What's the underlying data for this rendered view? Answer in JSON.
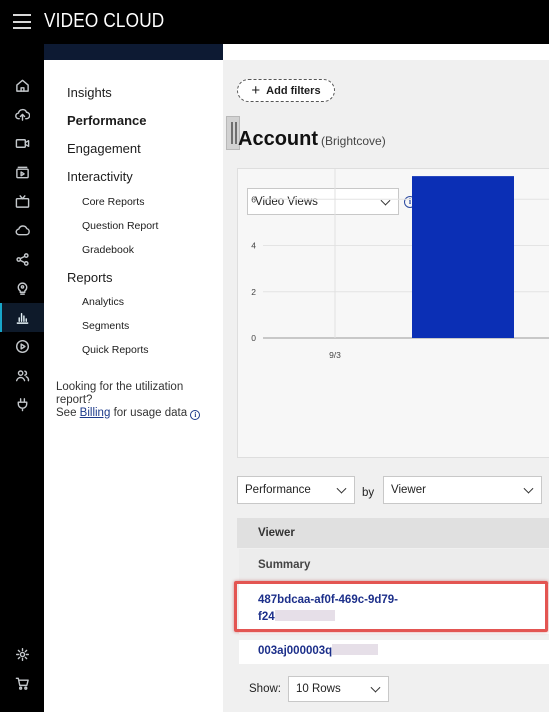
{
  "app": {
    "brand": "VIDEO CLOUD"
  },
  "rail": {
    "items": [
      "home",
      "upload",
      "media",
      "playlists",
      "live",
      "cloud",
      "social",
      "gallery",
      "analytics",
      "players",
      "users",
      "plugins",
      "settings",
      "cart"
    ],
    "active": "analytics"
  },
  "nav": {
    "insights": "Insights",
    "performance": "Performance",
    "engagement": "Engagement",
    "interactivity": "Interactivity",
    "core_reports": "Core Reports",
    "question_report": "Question Report",
    "gradebook": "Gradebook",
    "reports": "Reports",
    "analytics": "Analytics",
    "segments": "Segments",
    "quick_reports": "Quick Reports",
    "util_line1": "Looking for the utilization",
    "util_line2": "report?",
    "util_see": "See",
    "util_billing": "Billing",
    "util_rest": "for usage data"
  },
  "main": {
    "add_filters": "Add filters",
    "account_title": "Account",
    "account_sub": "(Brightcove)",
    "metric_select": "Video Views",
    "group_select": "Performance",
    "by": "by",
    "dimension_select": "Viewer",
    "table": {
      "header": "Viewer",
      "summary": "Summary",
      "rows": [
        {
          "line1": "487bdcaa-af0f-469c-9d79-",
          "line2": "f24"
        },
        {
          "line1": "003aj000003q"
        }
      ]
    },
    "show_label": "Show:",
    "rows_select": "10 Rows"
  },
  "chart_data": {
    "type": "bar",
    "categories": [
      "9/3",
      ""
    ],
    "values": [
      0,
      7
    ],
    "ylim": [
      0,
      8
    ],
    "yticks": [
      0,
      2,
      4,
      6,
      8
    ],
    "grid": true,
    "bar_color": "#0b2fb5"
  },
  "colors": {
    "accent": "#18a6c9",
    "link": "#1c2f8a",
    "highlight": "#e35552"
  }
}
